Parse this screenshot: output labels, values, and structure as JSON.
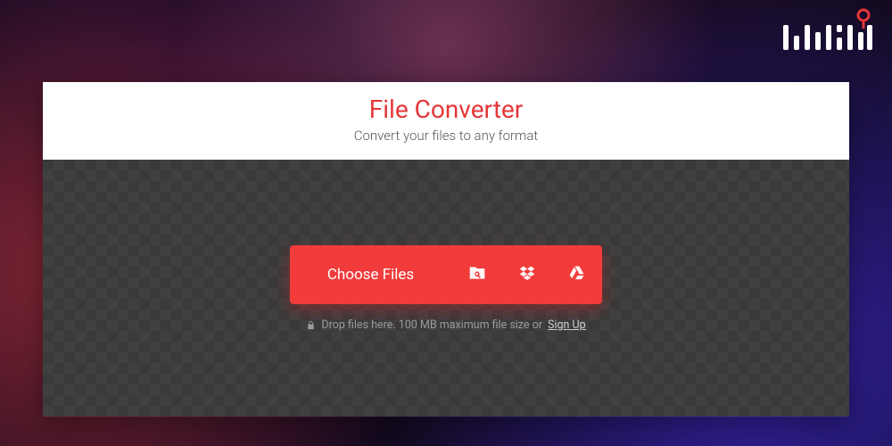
{
  "header": {
    "title": "File Converter",
    "subtitle": "Convert your files to any format"
  },
  "upload": {
    "choose_label": "Choose Files",
    "hint_prefix": "Drop files here. 100 MB maximum file size or",
    "signup_label": "Sign Up"
  },
  "colors": {
    "accent": "#f23b3b",
    "title": "#e53638"
  }
}
